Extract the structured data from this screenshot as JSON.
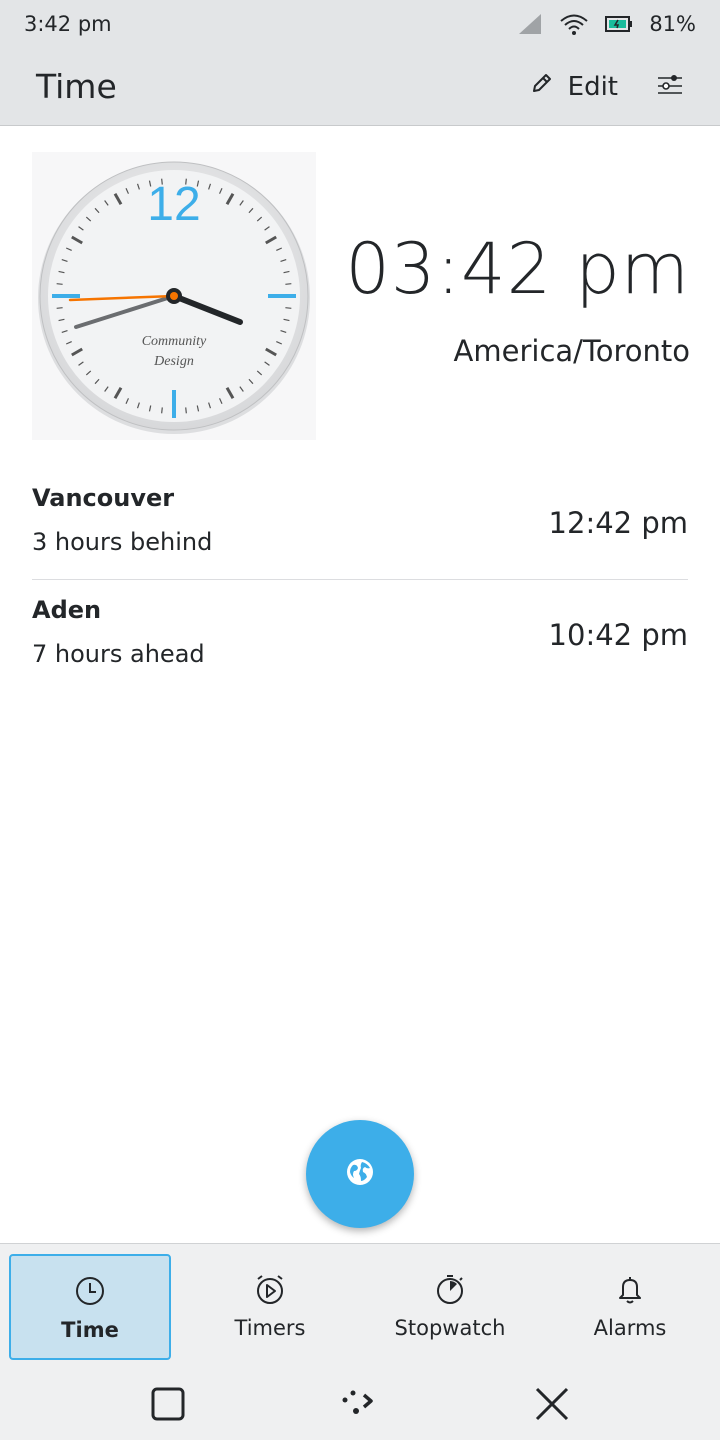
{
  "status": {
    "time": "3:42 pm",
    "battery": "81%"
  },
  "header": {
    "title": "Time",
    "edit_label": "Edit"
  },
  "main": {
    "time": "03:42 pm",
    "timezone": "America/Toronto"
  },
  "clock": {
    "twelve": "12",
    "brand_line1": "Community",
    "brand_line2": "Design"
  },
  "cities": [
    {
      "name": "Vancouver",
      "difference": "3 hours behind",
      "time": "12:42 pm"
    },
    {
      "name": "Aden",
      "difference": "7 hours ahead",
      "time": "10:42 pm"
    }
  ],
  "nav": [
    {
      "label": "Time",
      "icon": "clock-icon",
      "active": true
    },
    {
      "label": "Timers",
      "icon": "timer-icon",
      "active": false
    },
    {
      "label": "Stopwatch",
      "icon": "stopwatch-icon",
      "active": false
    },
    {
      "label": "Alarms",
      "icon": "bell-icon",
      "active": false
    }
  ],
  "fab": {
    "icon": "globe-icon"
  },
  "colors": {
    "accent": "#3daee9",
    "chrome": "#e3e5e7",
    "active_tab": "#c8e1ef"
  }
}
